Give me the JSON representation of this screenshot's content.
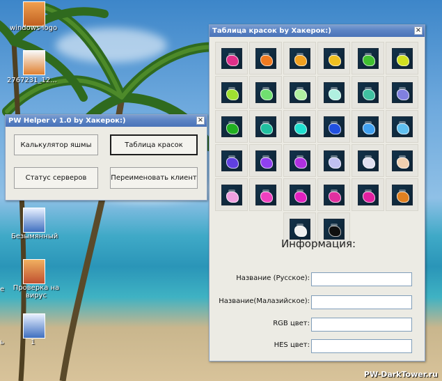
{
  "desktop": {
    "icons": [
      {
        "label": "windows-logo"
      },
      {
        "label": "2767231_12..."
      },
      {
        "label": "Безымянный"
      },
      {
        "label": "Проверка на вирус"
      },
      {
        "label": "1"
      }
    ],
    "left_labels": [
      "е",
      "ь"
    ],
    "watermark": "PW-DarkTower.ru"
  },
  "helper": {
    "title": "PW Helper v 1.0 by Хакерок:)",
    "buttons": {
      "jasper_calc": "Калькулятор яшмы",
      "dye_table": "Таблица красок",
      "server_status": "Статус серверов",
      "rename_client": "Переименовать клиент"
    }
  },
  "palette": {
    "title": "Таблица красок by Хакерок:)",
    "dye_colors": [
      "#e0308a",
      "#f07a20",
      "#f0a020",
      "#f0c020",
      "#40c030",
      "#d0e020",
      "#a0e030",
      "#70e070",
      "#b0f0a0",
      "#b0f0e0",
      "#40c0a0",
      "#8080e0",
      "#20b020",
      "#20c0a0",
      "#20e0d0",
      "#2050e0",
      "#40a0f0",
      "#60c0f0",
      "#6040e0",
      "#9040f0",
      "#b030e0",
      "#c0c0f0",
      "#e0e0f0",
      "#f0d0b0",
      "#f0a0e0",
      "#f040c0",
      "#e020c0",
      "#e030a0",
      "#e020a0",
      "#e08020",
      "#f0f0f0",
      "#101010"
    ],
    "info_heading": "Информация:",
    "fields": [
      {
        "label": "Название (Русское):",
        "value": ""
      },
      {
        "label": "Название(Малазийское):",
        "value": ""
      },
      {
        "label": "RGB цвет:",
        "value": ""
      },
      {
        "label": "HES цвет:",
        "value": ""
      }
    ]
  }
}
